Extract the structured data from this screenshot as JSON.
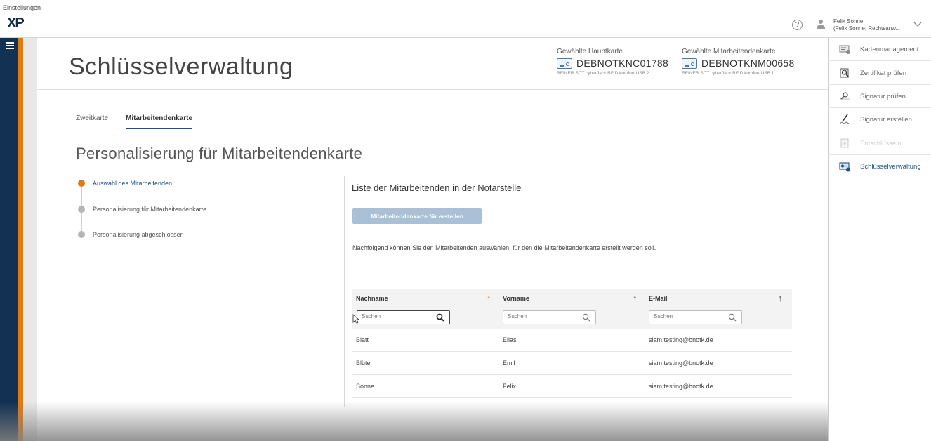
{
  "topbar": {
    "settings_label": "Einstellungen",
    "logo_text": "XP",
    "help_icon": "?",
    "user_line1": "Felix Sonne",
    "user_line2": "(Felix Sonne, Rechtsanw..."
  },
  "header": {
    "title": "Schlüsselverwaltung",
    "main_card": {
      "label": "Gewählte Hauptkarte",
      "number": "DEBNOTKNC01788",
      "reader": "REINER SCT cyberJack RFID komfort USB 2"
    },
    "employee_card": {
      "label": "Gewählte Mitarbeitendenkarte",
      "number": "DEBNOTKNM00658",
      "reader": "REINER SCT cyberJack RFID komfort USB 1"
    }
  },
  "tabs": [
    {
      "label": "Zweitkarte"
    },
    {
      "label": "Mitarbeitendenkarte"
    }
  ],
  "section_title": "Personalisierung für Mitarbeitendenkarte",
  "steps": [
    {
      "label": "Auswahl des Mitarbeitenden"
    },
    {
      "label": "Personalisierung für Mitarbeitendenkarte"
    },
    {
      "label": "Personalisierung abgeschlossen"
    }
  ],
  "list": {
    "title": "Liste der Mitarbeitenden in der Notarstelle",
    "create_button": "Mitarbeitendenkarte für erstellen",
    "info": "Nachfolgend können Sie den Mitarbeitenden auswählen, für den die Mitarbeitendenkarte erstellt werden soll.",
    "columns": [
      "Nachname",
      "Vorname",
      "E-Mail"
    ],
    "search_placeholder": "Suchen",
    "rows": [
      {
        "nachname": "Blatt",
        "vorname": "Elias",
        "email": "siam.testing@bnotk.de"
      },
      {
        "nachname": "Blüte",
        "vorname": "Emil",
        "email": "siam.testing@bnotk.de"
      },
      {
        "nachname": "Sonne",
        "vorname": "Felix",
        "email": "siam.testing@bnotk.de"
      }
    ]
  },
  "sidebar": {
    "items": [
      {
        "label": "Kartenmanagement",
        "icon": "card-reader-icon"
      },
      {
        "label": "Zertifikat prüfen",
        "icon": "certificate-icon"
      },
      {
        "label": "Signatur prüfen",
        "icon": "signature-check-icon"
      },
      {
        "label": "Signatur erstellen",
        "icon": "signature-pen-icon"
      },
      {
        "label": "Entschlüsseln",
        "icon": "decrypt-icon"
      },
      {
        "label": "Schlüsselverwaltung",
        "icon": "key-management-icon"
      }
    ]
  },
  "colors": {
    "navy": "#133152",
    "orange": "#e07b12",
    "accent_blue": "#1d4e80",
    "button_disabled": "#a9c0d6"
  }
}
